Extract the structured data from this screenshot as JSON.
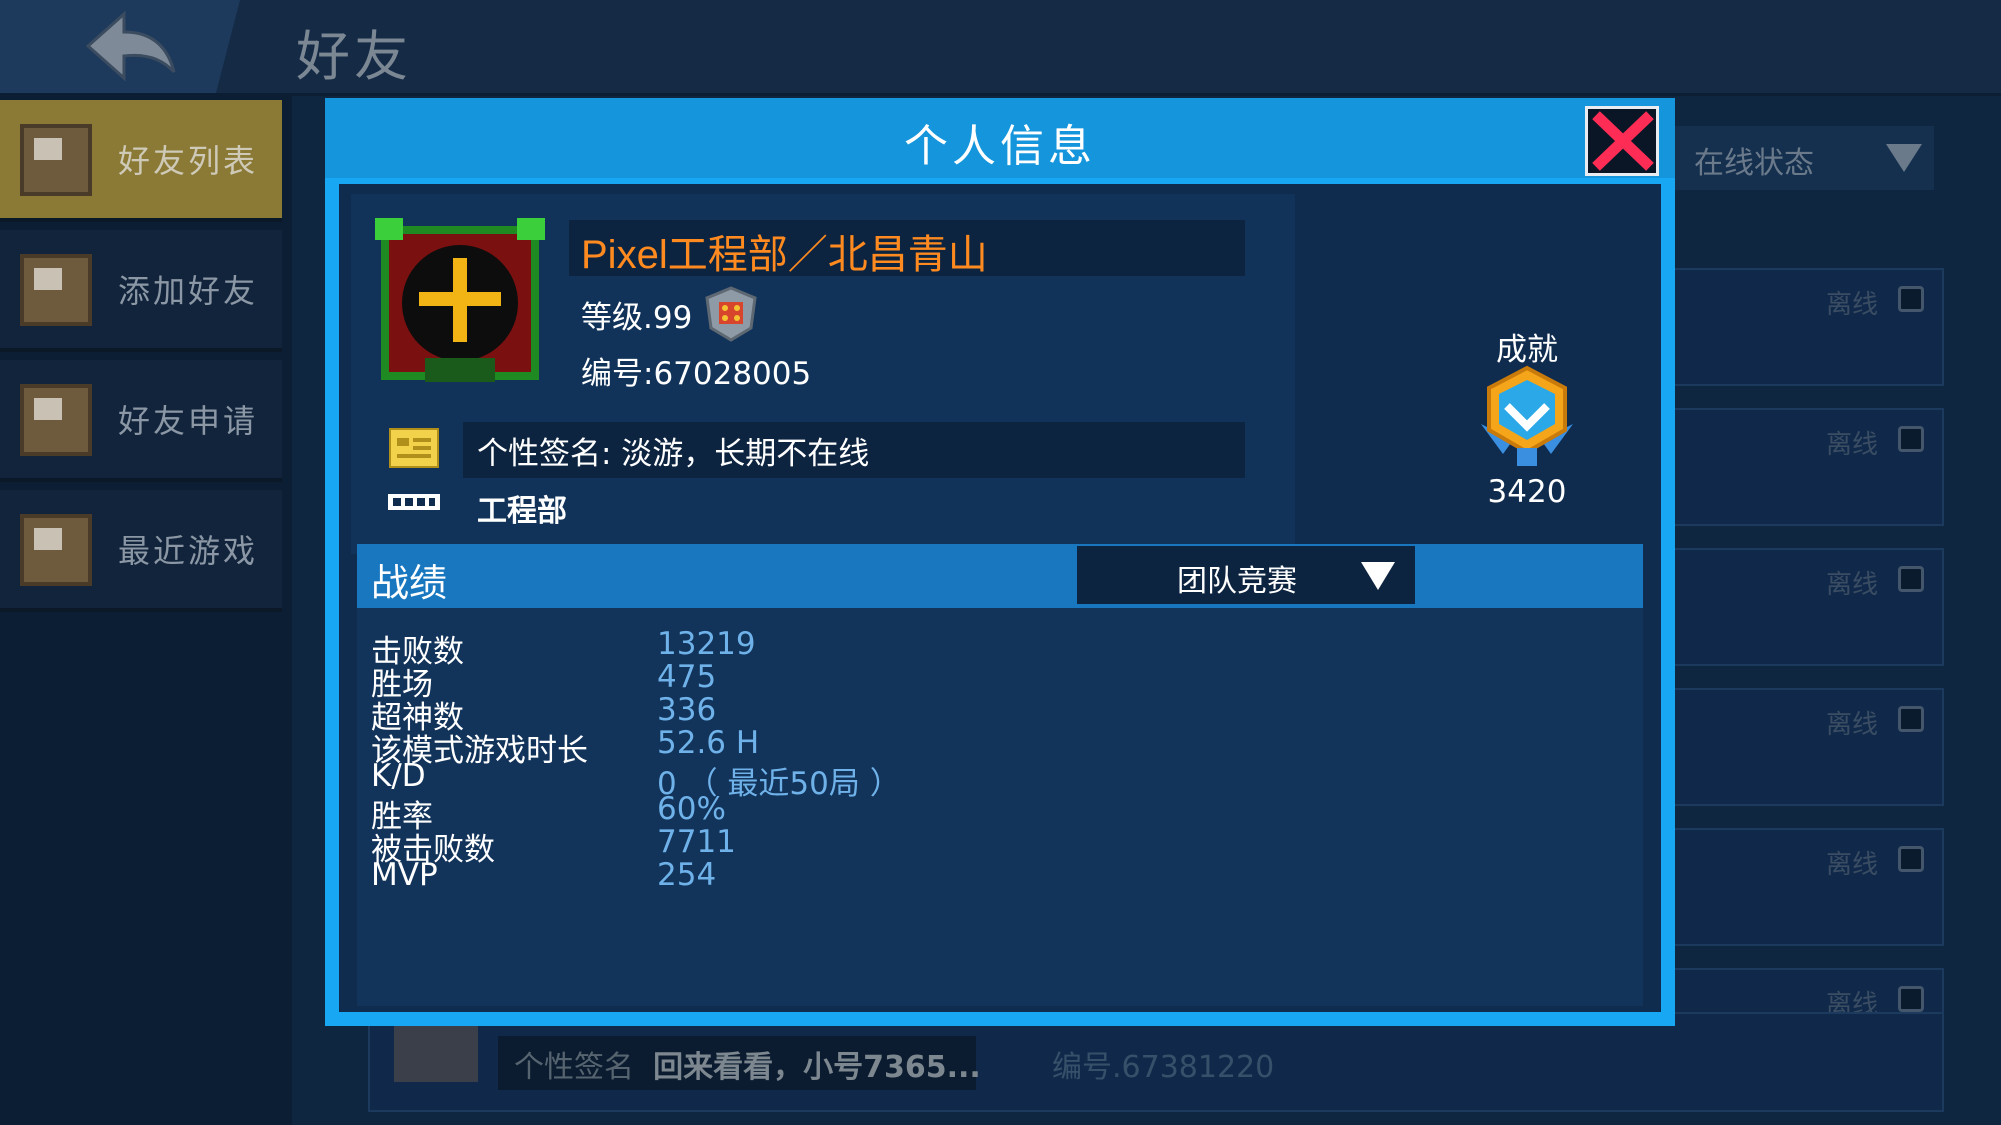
{
  "background": {
    "page_title": "好友",
    "sidebar": [
      {
        "label": "好友列表",
        "active": true
      },
      {
        "label": "添加好友",
        "active": false
      },
      {
        "label": "好友申请",
        "active": false
      },
      {
        "label": "最近游戏",
        "active": false
      }
    ],
    "status_filter": "在线状态",
    "friend_rows": [
      {
        "status": "离线"
      },
      {
        "status": "离线"
      },
      {
        "status": "离线"
      },
      {
        "status": "离线"
      },
      {
        "status": "离线"
      },
      {
        "status": "离线"
      }
    ],
    "bottom_row": {
      "signature_label": "个性签名",
      "signature_text": "回来看看，小号7365...",
      "id_text": "编号.67381220"
    }
  },
  "modal": {
    "title": "个人信息",
    "profile": {
      "name": "Pixel工程部／北昌青山",
      "level": "等级.99",
      "id": "编号:67028005",
      "signature": "个性签名: 淡游，长期不在线",
      "clan_tag": "工程部",
      "avatar_badge": "200"
    },
    "achievement": {
      "title": "成就",
      "value": "3420"
    },
    "stats": {
      "title": "战绩",
      "mode": "团队竞赛",
      "rows": [
        {
          "label": "击败数",
          "value": "13219"
        },
        {
          "label": "胜场",
          "value": "475"
        },
        {
          "label": "超神数",
          "value": "336"
        },
        {
          "label": "该模式游戏时长",
          "value": "52.6 H"
        },
        {
          "label": "K/D",
          "value": "0 （ 最近50局 ）"
        },
        {
          "label": "胜率",
          "value": "60%"
        },
        {
          "label": "被击败数",
          "value": "7711"
        },
        {
          "label": "MVP",
          "value": "254"
        }
      ]
    }
  },
  "colors": {
    "modal_frame": "#18a7f2",
    "name": "#ff8a1f",
    "stat_value": "#6fb2ea",
    "close_x": "#ff2d55"
  }
}
